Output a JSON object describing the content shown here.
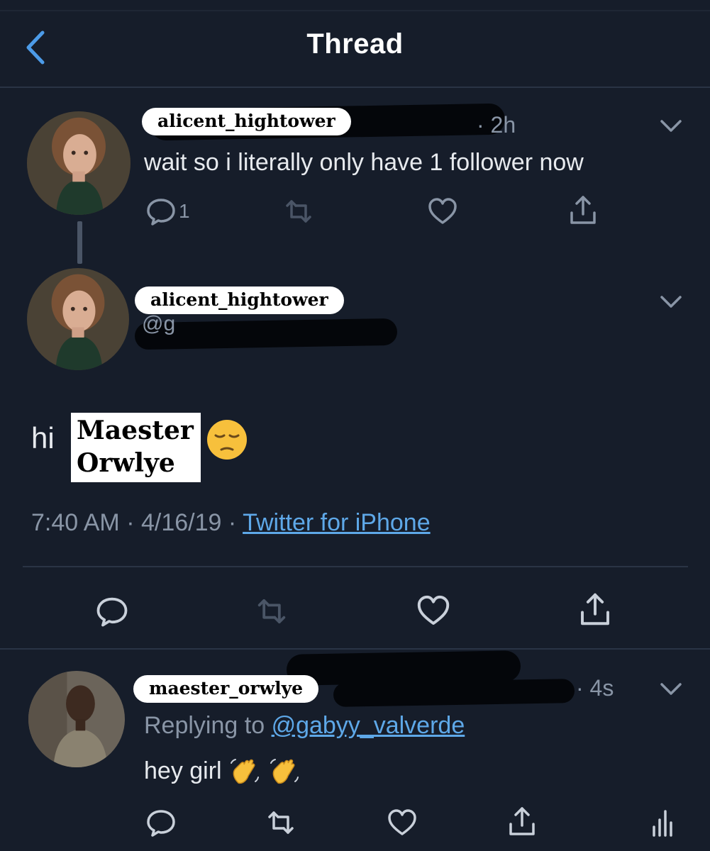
{
  "header": {
    "title": "Thread",
    "back_icon": "chevron-left-icon"
  },
  "tweets": [
    {
      "username": "alicent_hightower",
      "time": "· 2h",
      "text": "wait so i literally only have 1 follower now",
      "reply_count": "1",
      "menu_icon": "chevron-down-icon"
    },
    {
      "username": "alicent_hightower",
      "handle_partial": "@g",
      "text_prefix": "hi",
      "sticker_line1": "Maester",
      "sticker_line2": "Orwlye",
      "emoji": "pensive-face-icon",
      "time": "7:40 AM",
      "date": "4/16/19",
      "separator": "·",
      "source": "Twitter for iPhone"
    },
    {
      "username": "maester_orwlye",
      "time": "· 4s",
      "replying_prefix": "Replying to",
      "replying_to": "@gabyy_valverde",
      "text": "hey girl",
      "emoji": "waving-hand-icon"
    }
  ],
  "colors": {
    "background": "#161d2a",
    "link": "#5ea8e8",
    "muted": "#8995a6",
    "text": "#e7eaee"
  }
}
